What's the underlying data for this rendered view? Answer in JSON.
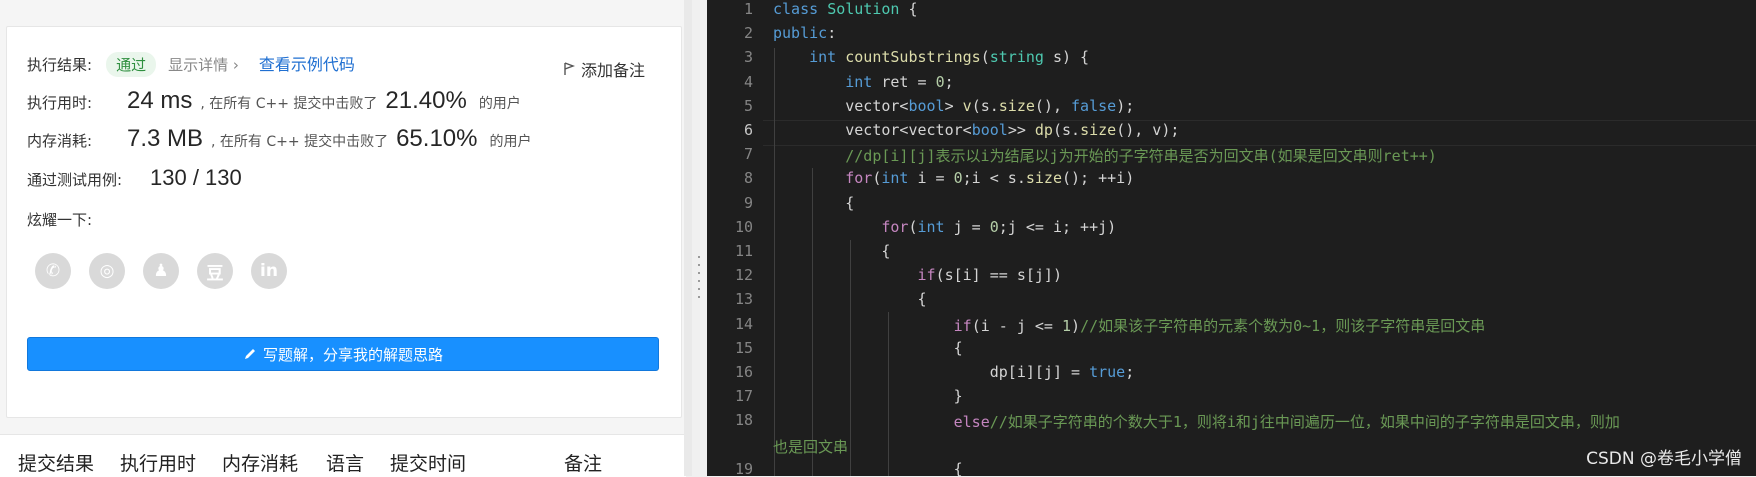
{
  "result": {
    "label": "执行结果:",
    "status": "通过",
    "details": "显示详情 ›",
    "sample": "查看示例代码",
    "note": "添加备注"
  },
  "runtime": {
    "label": "执行用时:",
    "value": "24 ms",
    "pre": ", 在所有 C++ 提交中击败了",
    "pct": "21.40%",
    "post": "的用户"
  },
  "memory": {
    "label": "内存消耗:",
    "value": "7.3 MB",
    "pre": ", 在所有 C++ 提交中击败了",
    "pct": "65.10%",
    "post": "的用户"
  },
  "tests": {
    "label": "通过测试用例:",
    "value": "130 / 130"
  },
  "share": {
    "label": "炫耀一下:",
    "icons": [
      {
        "name": "wechat-icon",
        "glyph": "✆"
      },
      {
        "name": "weibo-icon",
        "glyph": "◎"
      },
      {
        "name": "qq-icon",
        "glyph": "♟"
      },
      {
        "name": "douban-icon",
        "glyph": "豆"
      },
      {
        "name": "linkedin-icon",
        "glyph": "in"
      }
    ]
  },
  "solve_button": "写题解，分享我的解题思路",
  "tabs": [
    "提交结果",
    "执行用时",
    "内存消耗",
    "语言",
    "提交时间",
    "备注"
  ],
  "editor": {
    "line_numbers": [
      "1",
      "2",
      "3",
      "4",
      "5",
      "6",
      "7",
      "8",
      "9",
      "10",
      "11",
      "12",
      "13",
      "14",
      "15",
      "16",
      "17",
      "18",
      "",
      "19"
    ],
    "current_line": 6,
    "lines": [
      [
        [
          "kw",
          "class"
        ],
        [
          "p",
          " "
        ],
        [
          "ty",
          "Solution"
        ],
        [
          "p",
          " {"
        ]
      ],
      [
        [
          "kw",
          "public"
        ],
        [
          "p",
          ":"
        ]
      ],
      [
        [
          "p",
          "    "
        ],
        [
          "kw",
          "int"
        ],
        [
          "p",
          " "
        ],
        [
          "fn",
          "countSubstrings"
        ],
        [
          "p",
          "("
        ],
        [
          "ty",
          "string"
        ],
        [
          "p",
          " s) {"
        ]
      ],
      [
        [
          "p",
          "        "
        ],
        [
          "kw",
          "int"
        ],
        [
          "p",
          " ret = "
        ],
        [
          "nu",
          "0"
        ],
        [
          "p",
          ";"
        ]
      ],
      [
        [
          "p",
          "        vector<"
        ],
        [
          "kw",
          "bool"
        ],
        [
          "p",
          "> "
        ],
        [
          "fn",
          "v"
        ],
        [
          "p",
          "(s."
        ],
        [
          "fn",
          "size"
        ],
        [
          "p",
          "(), "
        ],
        [
          "kw",
          "false"
        ],
        [
          "p",
          ");"
        ]
      ],
      [
        [
          "p",
          "        vector<vector<"
        ],
        [
          "kw",
          "bool"
        ],
        [
          "p",
          ">> "
        ],
        [
          "fn",
          "dp"
        ],
        [
          "p",
          "(s."
        ],
        [
          "fn",
          "size"
        ],
        [
          "p",
          "(), v);"
        ]
      ],
      [
        [
          "p",
          "        "
        ],
        [
          "cm",
          "//dp[i][j]表示以i为结尾以j为开始的子字符串是否为回文串(如果是回文串则ret++)"
        ]
      ],
      [
        [
          "p",
          "        "
        ],
        [
          "ct",
          "for"
        ],
        [
          "p",
          "("
        ],
        [
          "kw",
          "int"
        ],
        [
          "p",
          " i = "
        ],
        [
          "nu",
          "0"
        ],
        [
          "p",
          ";i < s."
        ],
        [
          "fn",
          "size"
        ],
        [
          "p",
          "(); ++i)"
        ]
      ],
      [
        [
          "p",
          "        {"
        ]
      ],
      [
        [
          "p",
          "            "
        ],
        [
          "ct",
          "for"
        ],
        [
          "p",
          "("
        ],
        [
          "kw",
          "int"
        ],
        [
          "p",
          " j = "
        ],
        [
          "nu",
          "0"
        ],
        [
          "p",
          ";j <= i; ++j)"
        ]
      ],
      [
        [
          "p",
          "            {"
        ]
      ],
      [
        [
          "p",
          "                "
        ],
        [
          "ct",
          "if"
        ],
        [
          "p",
          "(s[i] == s[j])"
        ]
      ],
      [
        [
          "p",
          "                {"
        ]
      ],
      [
        [
          "p",
          "                    "
        ],
        [
          "ct",
          "if"
        ],
        [
          "p",
          "(i - j <= "
        ],
        [
          "nu",
          "1"
        ],
        [
          "p",
          ")"
        ],
        [
          "cm",
          "//如果该子字符串的元素个数为0~1，则该子字符串是回文串"
        ]
      ],
      [
        [
          "p",
          "                    {"
        ]
      ],
      [
        [
          "p",
          "                        dp[i][j] = "
        ],
        [
          "kw",
          "true"
        ],
        [
          "p",
          ";"
        ]
      ],
      [
        [
          "p",
          "                    }"
        ]
      ],
      [
        [
          "p",
          "                    "
        ],
        [
          "ct",
          "else"
        ],
        [
          "cm",
          "//如果子字符串的个数大于1，则将i和j往中间遍历一位，如果中间的子字符串是回文串，则加"
        ]
      ],
      [
        [
          "cm",
          "也是回文串"
        ]
      ],
      [
        [
          "p",
          "                    {"
        ]
      ]
    ]
  },
  "watermark": "CSDN @卷毛小学僧",
  "colors": {
    "accent": "#1890ff",
    "pass": "#2f8f3f",
    "editor_bg": "#1e1e1e"
  }
}
